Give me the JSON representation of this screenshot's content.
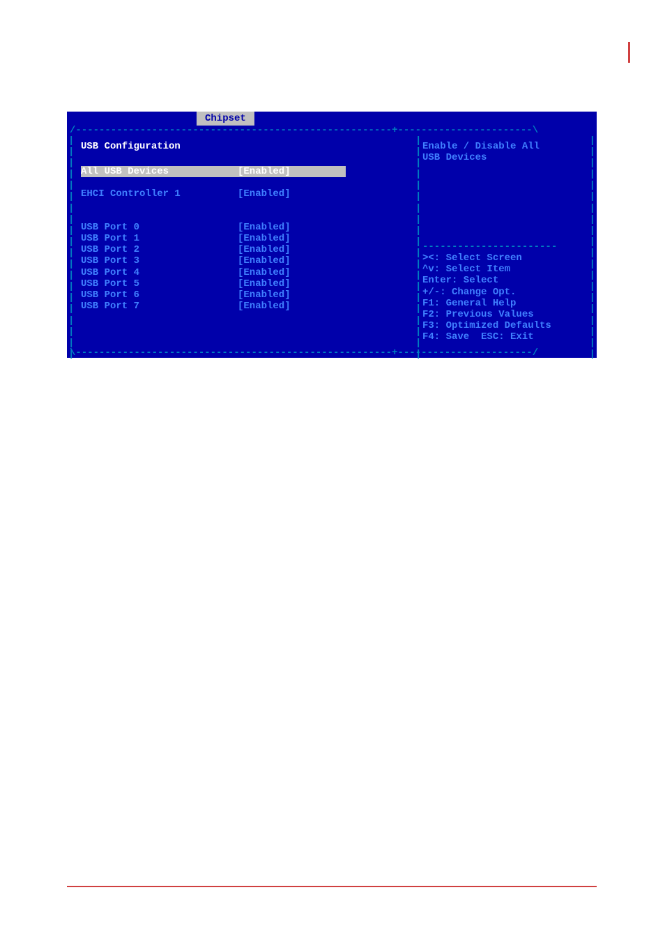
{
  "tab": {
    "label": "Chipset"
  },
  "leftPanel": {
    "sectionTitle": "USB Configuration",
    "settings": [
      {
        "label": "All USB Devices",
        "value": "[Enabled]",
        "selected": true
      },
      {
        "label": "",
        "value": "",
        "blank": true
      },
      {
        "label": "EHCI Controller 1",
        "value": "[Enabled]"
      },
      {
        "label": "",
        "value": "",
        "blank": true
      },
      {
        "label": "",
        "value": "",
        "blank": true
      },
      {
        "label": "USB Port 0",
        "value": "[Enabled]"
      },
      {
        "label": "USB Port 1",
        "value": "[Enabled]"
      },
      {
        "label": "USB Port 2",
        "value": "[Enabled]"
      },
      {
        "label": "USB Port 3",
        "value": "[Enabled]"
      },
      {
        "label": "USB Port 4",
        "value": "[Enabled]"
      },
      {
        "label": "USB Port 5",
        "value": "[Enabled]"
      },
      {
        "label": "USB Port 6",
        "value": "[Enabled]"
      },
      {
        "label": "USB Port 7",
        "value": "[Enabled]"
      }
    ]
  },
  "rightPanel": {
    "helpDescription": "Enable / Disable All\nUSB Devices",
    "navHelp": [
      "><: Select Screen",
      "^v: Select Item",
      "Enter: Select",
      "+/-: Change Opt.",
      "F1: General Help",
      "F2: Previous Values",
      "F3: Optimized Defaults",
      "F4: Save  ESC: Exit"
    ]
  },
  "borders": {
    "top": "/------------------------------------------------------+-----------------------\\",
    "bottom": "\\------------------------------------------------------+-----------------------/",
    "divider": "-----------------------"
  }
}
